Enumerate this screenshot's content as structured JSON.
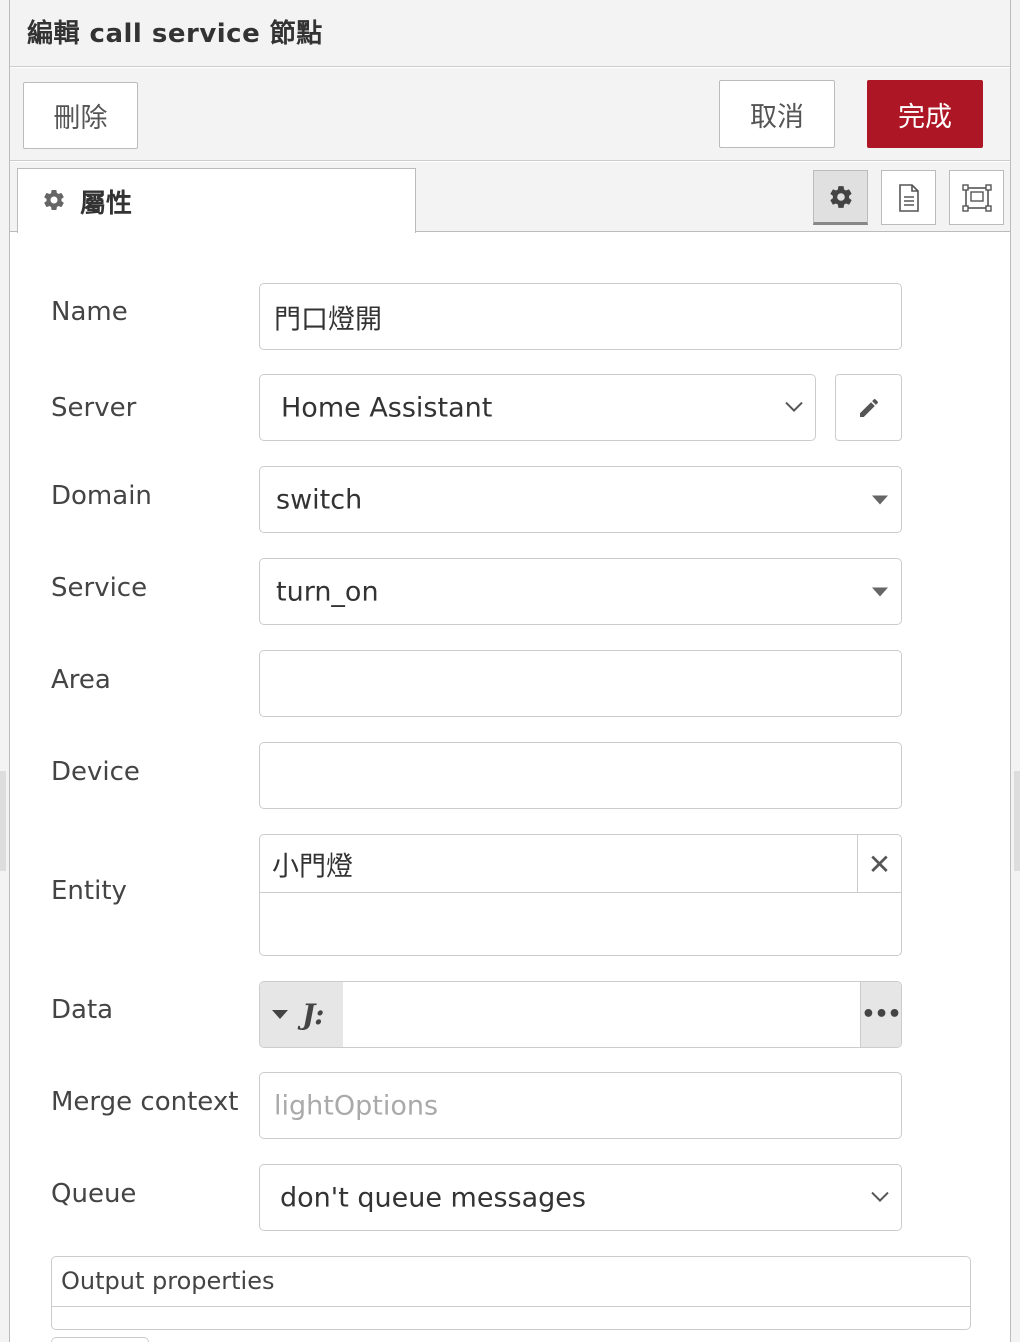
{
  "header": {
    "title": "編輯 call service 節點"
  },
  "toolbar": {
    "delete_label": "刪除",
    "cancel_label": "取消",
    "done_label": "完成"
  },
  "tabs": [
    {
      "label": "屬性",
      "icon": "gear-icon"
    }
  ],
  "tab_icons": [
    "gear-icon",
    "document-icon",
    "frame-icon"
  ],
  "form": {
    "name": {
      "label": "Name",
      "value": "門口燈開"
    },
    "server": {
      "label": "Server",
      "value": "Home Assistant"
    },
    "domain": {
      "label": "Domain",
      "value": "switch"
    },
    "service": {
      "label": "Service",
      "value": "turn_on"
    },
    "area": {
      "label": "Area",
      "value": ""
    },
    "device": {
      "label": "Device",
      "value": ""
    },
    "entity": {
      "label": "Entity",
      "value": "小門燈",
      "remove_label": "✕"
    },
    "data": {
      "label": "Data",
      "type_icon": "J:",
      "more_label": "•••"
    },
    "merge_context": {
      "label": "Merge context",
      "placeholder": "lightOptions"
    },
    "queue": {
      "label": "Queue",
      "value": "don't queue messages"
    }
  },
  "output": {
    "label": "Output properties"
  },
  "colors": {
    "primary_button": "#ad1625",
    "panel_bg": "#f3f3f3"
  }
}
